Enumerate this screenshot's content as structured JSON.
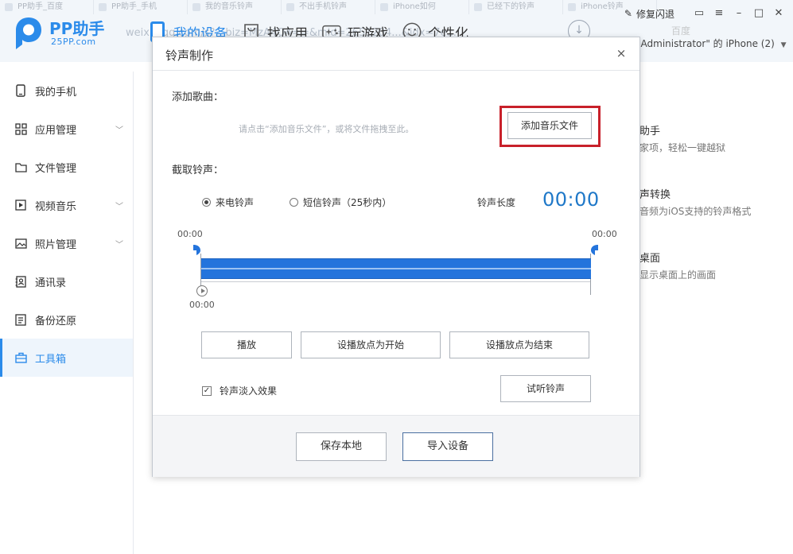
{
  "browser_tabs": [
    "PP助手_百度",
    "PP助手_手机",
    "我的音乐铃声",
    "不出手机铃声",
    "iPhone如何",
    "已经下的铃声",
    "iPhone铃声"
  ],
  "url_ghost": "weixin.qq.com/s?__biz=MzA4OA==&mid=2651204...&idx=7e...",
  "app": {
    "name": "PP助手",
    "site": "25PP.com",
    "brand_color": "#2b8bea"
  },
  "nav": [
    {
      "label": "我的设备",
      "icon": "phone-icon",
      "active": true
    },
    {
      "label": "找应用",
      "icon": "bag-icon",
      "active": false
    },
    {
      "label": "玩游戏",
      "icon": "gamepad-icon",
      "active": false
    },
    {
      "label": "个性化",
      "icon": "smiley-icon",
      "active": false
    }
  ],
  "window": {
    "repair_label": "修复闪退",
    "search_ghost": "百度"
  },
  "device": {
    "label": "\"Administrator\" 的 iPhone (2)"
  },
  "sidebar": [
    {
      "label": "我的手机",
      "icon": "phone-outline-icon",
      "expandable": false
    },
    {
      "label": "应用管理",
      "icon": "grid-icon",
      "expandable": true
    },
    {
      "label": "文件管理",
      "icon": "folder-icon",
      "expandable": false
    },
    {
      "label": "视频音乐",
      "icon": "video-icon",
      "expandable": true
    },
    {
      "label": "照片管理",
      "icon": "photo-icon",
      "expandable": true
    },
    {
      "label": "通讯录",
      "icon": "contacts-icon",
      "expandable": false
    },
    {
      "label": "备份还原",
      "icon": "backup-icon",
      "expandable": false
    },
    {
      "label": "工具箱",
      "icon": "toolbox-icon",
      "expandable": false,
      "active": true
    }
  ],
  "bg_tools": [
    {
      "title": "助手",
      "desc": "家项，轻松一键越狱"
    },
    {
      "title": "声转换",
      "desc": "音频为iOS支持的铃声格式"
    },
    {
      "title": "桌面",
      "desc": "显示桌面上的画面"
    }
  ],
  "dialog": {
    "title": "铃声制作",
    "close": "×",
    "add_song_title": "添加歌曲：",
    "drop_hint": "请点击“添加音乐文件”，或将文件拖拽至此。",
    "add_file_button": "添加音乐文件",
    "trim_title": "截取铃声：",
    "radio_call": "来电铃声",
    "radio_sms": "短信铃声（25秒内）",
    "radio_selected": "call",
    "length_label": "铃声长度",
    "length_value": "00:00",
    "start_time": "00:00",
    "end_time": "00:00",
    "play_time": "00:00",
    "play_button": "播放",
    "set_start_button": "设播放点为开始",
    "set_end_button": "设播放点为结束",
    "fade_label": "铃声淡入效果",
    "fade_checked": true,
    "preview_button": "试听铃声",
    "save_local_button": "保存本地",
    "import_device_button": "导入设备"
  }
}
